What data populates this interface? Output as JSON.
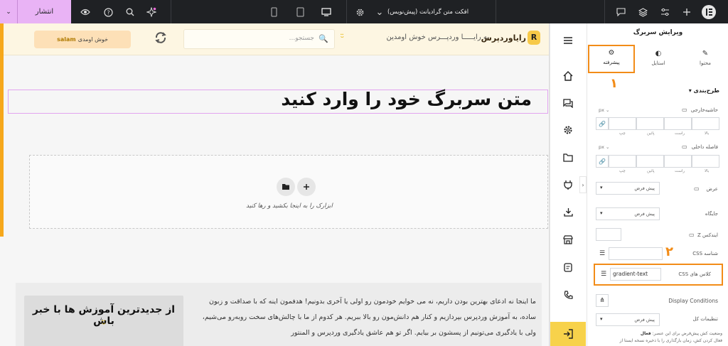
{
  "topbar": {
    "publish_label": "انتشار",
    "doc_title": "افکت متن گرادیانت (پیش‌نویس)",
    "icons": [
      "chevron-down-icon",
      "eye-icon",
      "help-icon",
      "search-icon",
      "sparkle-icon",
      "mobile-icon",
      "tablet-icon",
      "desktop-icon",
      "gear-icon",
      "chevron-down-icon",
      "comment-icon",
      "layers-icon",
      "sliders-icon",
      "plus-icon",
      "elementor-logo"
    ]
  },
  "site": {
    "welcome_text": "خوش اومدی",
    "welcome_user": "salam",
    "search_placeholder": "جستجو...",
    "greeting": "به رایـــــا وردپـــرس خوش اومدین",
    "logo_text": "رایاوردپرس",
    "logo_mark": "R"
  },
  "canvas": {
    "headline": "متن سربرگ خود را وارد کنید",
    "dropzone_text": "ابزارک را به اینجا بکشید و رها کنید",
    "cta_title": "از جدیدترین آموزش ها با خبر باش",
    "cta_face": "ᵕ̈",
    "paragraph": "ما اینجا نه ادعای بهترین بودن داریم، نه می خوایم خودمون رو اولی یا آخری بدونیم! هدفمون اینه که با صداقت و زبون ساده، به آموزش وردپرس بپردازیم و کنار هم دانش‌مون رو بالا ببریم. هر کدوم از ما با چالش‌های سخت روبه‌رو می‌شیم، ولی با یادگیری می‌تونیم از پسشون بر بیایم. اگر تو هم عاشق یادگیری وردپرس و المنتور"
  },
  "panel": {
    "title": "ویرایش سربرگ",
    "tabs": [
      {
        "label": "محتوا",
        "icon": "pencil-icon"
      },
      {
        "label": "استایل",
        "icon": "contrast-icon"
      },
      {
        "label": "پیشرفته",
        "icon": "gear-icon"
      }
    ],
    "annotation_1": "۱",
    "annotation_2": "۲",
    "section_layout": "طرح‌بندی",
    "margin_label": "حاشیه‌خارجی",
    "padding_label": "فاصله داخلی",
    "unit": "px",
    "dim_labels": [
      "بالا",
      "راست",
      "پائین",
      "چپ"
    ],
    "width_label": "عرض",
    "width_value": "پیش فرض",
    "position_label": "جایگاه",
    "position_value": "پیش فرض",
    "zindex_label": "ایندکس Z",
    "css_id_label": "شناسه CSS",
    "css_classes_label": "کلاس های CSS",
    "css_classes_value": "gradient-text",
    "display_conditions_label": "Display Conditions",
    "motion_label": "تنظیمات کل",
    "motion_value": "پیش فرض",
    "note_text": "وضعیت کش پیش‌فرض برای این عنصر:",
    "note_status": "فعال",
    "note_text_2": "فعال کردن کش، زمان بارگذاری را با ذخیره نسخه ایستا از"
  },
  "colors": {
    "topbar_bg": "#1f2124",
    "publish_bg": "#e9b3f5",
    "annotation": "#f28c18",
    "exit_bg": "#f7d24b",
    "site_header_bg": "#fdf6e2"
  }
}
